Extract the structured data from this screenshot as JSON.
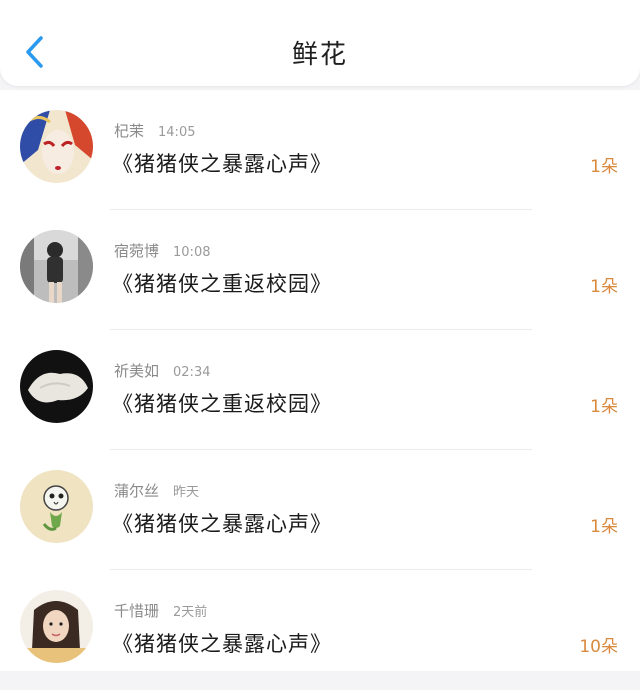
{
  "header": {
    "back_icon": "chevron-left-icon",
    "title": "鲜花",
    "accent_color": "#2a9af0"
  },
  "records": [
    {
      "name": "杞茉",
      "time": "14:05",
      "gift": "《猪猪侠之暴露心声》",
      "count": "1朵"
    },
    {
      "name": "宿菀博",
      "time": "10:08",
      "gift": "《猪猪侠之重返校园》",
      "count": "1朵"
    },
    {
      "name": "祈美如",
      "time": "02:34",
      "gift": "《猪猪侠之重返校园》",
      "count": "1朵"
    },
    {
      "name": "蒲尔丝",
      "time": "昨天",
      "gift": "《猪猪侠之暴露心声》",
      "count": "1朵"
    },
    {
      "name": "千惜珊",
      "time": "2天前",
      "gift": "《猪猪侠之暴露心声》",
      "count": "10朵"
    }
  ],
  "count_color": "#d98a3e"
}
